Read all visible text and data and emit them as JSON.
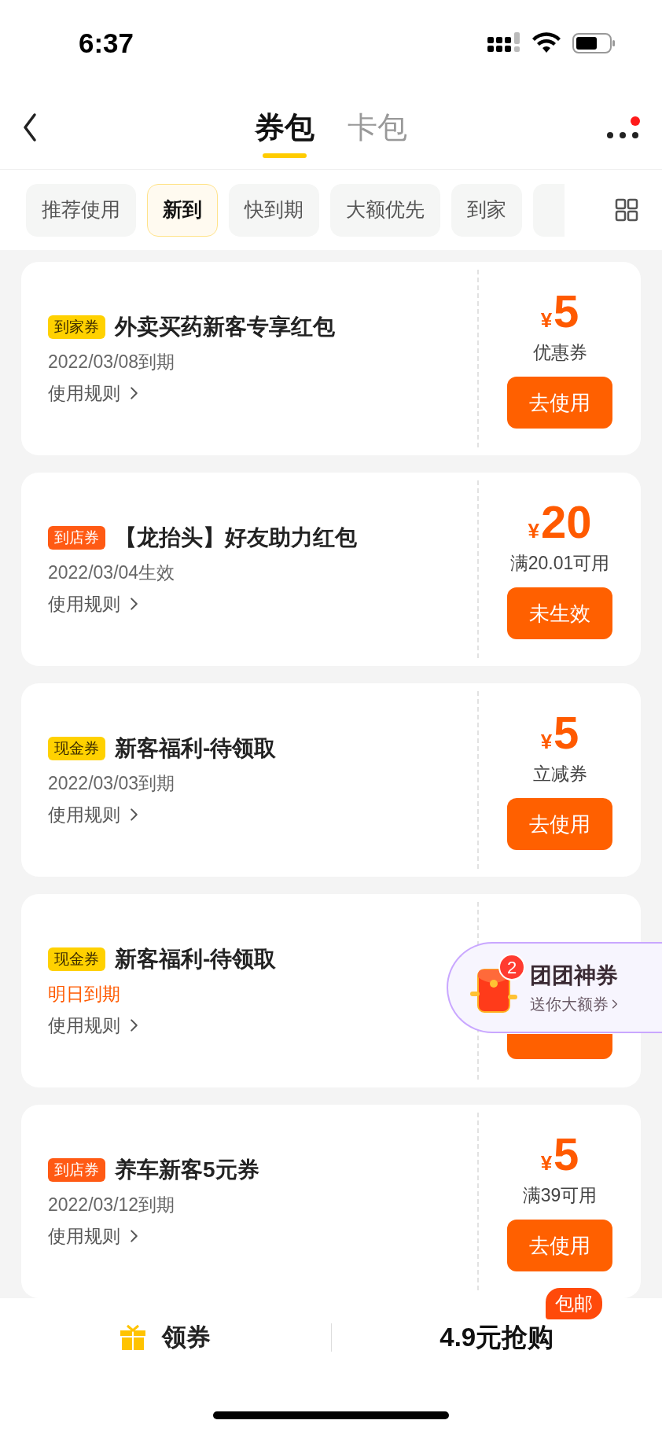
{
  "status_bar": {
    "time": "6:37"
  },
  "nav": {
    "tabs": [
      {
        "label": "券包",
        "selected": true
      },
      {
        "label": "卡包",
        "selected": false
      }
    ],
    "more_badge": true
  },
  "filters": [
    {
      "label": "推荐使用",
      "selected": false
    },
    {
      "label": "新到",
      "selected": true
    },
    {
      "label": "快到期",
      "selected": false
    },
    {
      "label": "大额优先",
      "selected": false
    },
    {
      "label": "到家",
      "selected": false
    }
  ],
  "coupons": [
    {
      "tag": {
        "label": "到家券",
        "color": "#ffd100"
      },
      "title": "外卖买药新客专享红包",
      "date": {
        "text": "2022/03/08到期",
        "urgent": false
      },
      "rules": "使用规则",
      "currency": "¥",
      "amount": "5",
      "condition": "优惠券",
      "button": "去使用"
    },
    {
      "tag": {
        "label": "到店券",
        "color": "#ff5a14"
      },
      "title": "【龙抬头】好友助力红包",
      "date": {
        "text": "2022/03/04生效",
        "urgent": false
      },
      "rules": "使用规则",
      "currency": "¥",
      "amount": "20",
      "condition": "满20.01可用",
      "button": "未生效"
    },
    {
      "tag": {
        "label": "现金券",
        "color": "#ffd100"
      },
      "title": "新客福利-待领取",
      "date": {
        "text": "2022/03/03到期",
        "urgent": false
      },
      "rules": "使用规则",
      "currency": "¥",
      "amount": "5",
      "condition": "立减券",
      "button": "去使用"
    },
    {
      "tag": {
        "label": "现金券",
        "color": "#ffd100"
      },
      "title": "新客福利-待领取",
      "date": {
        "text": "明日到期",
        "urgent": true
      },
      "rules": "使用规则"
    },
    {
      "tag": {
        "label": "到店券",
        "color": "#ff5a14"
      },
      "title": "养车新客5元券",
      "date": {
        "text": "2022/03/12到期",
        "urgent": false
      },
      "rules": "使用规则",
      "currency": "¥",
      "amount": "5",
      "condition": "满39可用",
      "button": "去使用"
    }
  ],
  "floating_widget": {
    "badge": "2",
    "title": "团团神券",
    "subtitle": "送你大额券"
  },
  "bottom_bar": {
    "left": "领券",
    "right": "4.9元抢购",
    "right_badge": "包邮"
  }
}
